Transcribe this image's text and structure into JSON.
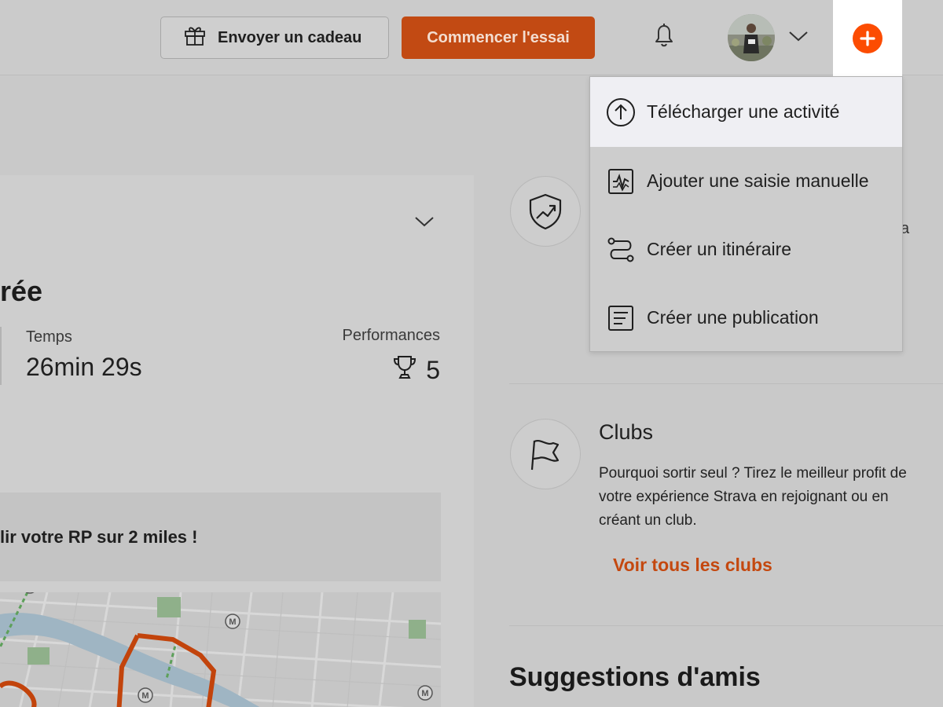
{
  "topbar": {
    "gift_label": "Envoyer un cadeau",
    "trial_label": "Commencer l'essai",
    "accent": "#fc4c02"
  },
  "dropdown": {
    "items": [
      {
        "label": "Télécharger une activité",
        "icon": "upload-icon"
      },
      {
        "label": "Ajouter une saisie manuelle",
        "icon": "manual-entry-icon"
      },
      {
        "label": "Créer un itinéraire",
        "icon": "route-icon"
      },
      {
        "label": "Créer une publication",
        "icon": "post-icon"
      }
    ]
  },
  "activity": {
    "title_partial": "rée",
    "time_label": "Temps",
    "time_value": "26min 29s",
    "performance_label": "Performances",
    "performance_value": "5",
    "banner_text": "lir votre RP sur 2 miles !"
  },
  "clubs": {
    "title": "Clubs",
    "description": "Pourquoi sortir seul ? Tirez le meilleur profit de votre expérience Strava en rejoignant ou en créant un club.",
    "link": "Voir tous les clubs"
  },
  "suggestions": {
    "title": "Suggestions d'amis"
  },
  "misc": {
    "stray_char": "a"
  }
}
